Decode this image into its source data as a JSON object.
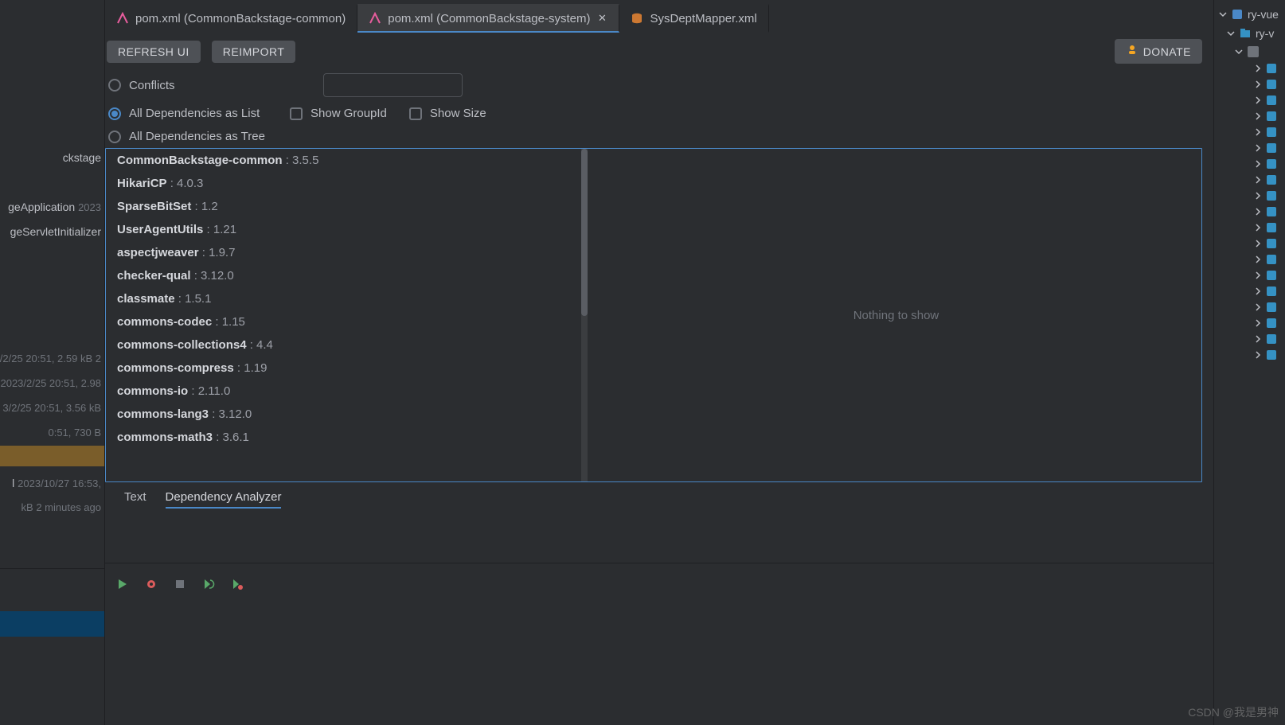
{
  "tabs": [
    {
      "label": "pom.xml (CommonBackstage-common)",
      "icon": "maven"
    },
    {
      "label": "pom.xml (CommonBackstage-system)",
      "icon": "maven",
      "active": true,
      "closable": true
    },
    {
      "label": "SysDeptMapper.xml",
      "icon": "db"
    }
  ],
  "buttons": {
    "refresh": "REFRESH UI",
    "reimport": "REIMPORT",
    "donate": "DONATE"
  },
  "search": {
    "placeholder": ""
  },
  "radios": {
    "conflicts": "Conflicts",
    "all_list": "All Dependencies as List",
    "all_tree": "All Dependencies as Tree"
  },
  "checkboxes": {
    "show_group": "Show GroupId",
    "show_size": "Show Size"
  },
  "deps": [
    {
      "name": "CommonBackstage-common",
      "ver": "3.5.5"
    },
    {
      "name": "HikariCP",
      "ver": "4.0.3"
    },
    {
      "name": "SparseBitSet",
      "ver": "1.2"
    },
    {
      "name": "UserAgentUtils",
      "ver": "1.21"
    },
    {
      "name": "aspectjweaver",
      "ver": "1.9.7"
    },
    {
      "name": "checker-qual",
      "ver": "3.12.0"
    },
    {
      "name": "classmate",
      "ver": "1.5.1"
    },
    {
      "name": "commons-codec",
      "ver": "1.15"
    },
    {
      "name": "commons-collections4",
      "ver": "4.4"
    },
    {
      "name": "commons-compress",
      "ver": "1.19"
    },
    {
      "name": "commons-io",
      "ver": "2.11.0"
    },
    {
      "name": "commons-lang3",
      "ver": "3.12.0"
    },
    {
      "name": "commons-math3",
      "ver": "3.6.1"
    }
  ],
  "right_empty": "Nothing to show",
  "bottom_tabs": {
    "text": "Text",
    "analyzer": "Dependency Analyzer"
  },
  "left_items": {
    "i1": "ckstage",
    "i2": "geApplication",
    "i2t": "2023",
    "i3": "geServletInitializer",
    "t1": "/2/25 20:51, 2.59 kB 2",
    "t2": "2023/2/25 20:51, 2.98",
    "t3": "3/2/25 20:51, 3.56 kB",
    "t4": "0:51, 730 B",
    "t5": "2023/10/27 16:53, ",
    "t5pre": "l",
    "t6": "kB 2 minutes ago"
  },
  "right_tree": {
    "root": "ry-vue",
    "sub": "ry-v"
  },
  "watermark": "CSDN @我是男神"
}
